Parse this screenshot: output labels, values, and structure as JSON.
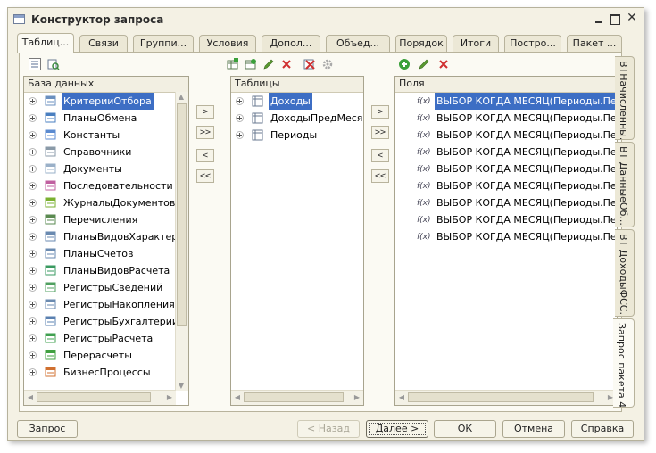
{
  "window": {
    "title": "Конструктор запроса"
  },
  "tabs": [
    {
      "label": "Таблиц..."
    },
    {
      "label": "Связи"
    },
    {
      "label": "Группи..."
    },
    {
      "label": "Условия"
    },
    {
      "label": "Допол..."
    },
    {
      "label": "Объед..."
    },
    {
      "label": "Порядок"
    },
    {
      "label": "Итоги"
    },
    {
      "label": "Постро..."
    },
    {
      "label": "Пакет ..."
    }
  ],
  "side_tabs": [
    {
      "label": "ВТНачисленны..."
    },
    {
      "label": "ВТ ДанныеОб..."
    },
    {
      "label": "ВТ ДоходыФСС..."
    },
    {
      "label": "Запрос пакета 4"
    }
  ],
  "database": {
    "header": "База данных",
    "items": [
      {
        "label": "КритерииОтбора",
        "icon": "filter-criteria-icon",
        "color": "#6a8fbf"
      },
      {
        "label": "ПланыОбмена",
        "icon": "exchange-plan-icon",
        "color": "#4a7fc0"
      },
      {
        "label": "Константы",
        "icon": "constants-icon",
        "color": "#5a8ad0"
      },
      {
        "label": "Справочники",
        "icon": "catalog-icon",
        "color": "#8a9aa8"
      },
      {
        "label": "Документы",
        "icon": "document-icon",
        "color": "#9ab0c8"
      },
      {
        "label": "Последовательности",
        "icon": "sequence-icon",
        "color": "#c060a0"
      },
      {
        "label": "ЖурналыДокументов",
        "icon": "document-journal-icon",
        "color": "#7ab030"
      },
      {
        "label": "Перечисления",
        "icon": "enumeration-icon",
        "color": "#5a8a50"
      },
      {
        "label": "ПланыВидовХарактерис",
        "icon": "characteristic-plan-icon",
        "color": "#6a8ab0"
      },
      {
        "label": "ПланыСчетов",
        "icon": "chart-of-accounts-icon",
        "color": "#6a8ab0"
      },
      {
        "label": "ПланыВидовРасчета",
        "icon": "calculation-plan-icon",
        "color": "#3a9a60"
      },
      {
        "label": "РегистрыСведений",
        "icon": "info-register-icon",
        "color": "#50a060"
      },
      {
        "label": "РегистрыНакопления",
        "icon": "accumulation-register-icon",
        "color": "#6a8ab0"
      },
      {
        "label": "РегистрыБухгалтерии",
        "icon": "accounting-register-icon",
        "color": "#5a80b0"
      },
      {
        "label": "РегистрыРасчета",
        "icon": "calculation-register-icon",
        "color": "#40a050"
      },
      {
        "label": "Перерасчеты",
        "icon": "recalculation-icon",
        "color": "#40a040"
      },
      {
        "label": "БизнесПроцессы",
        "icon": "business-process-icon",
        "color": "#d07030"
      }
    ]
  },
  "tables": {
    "header": "Таблицы",
    "items": [
      {
        "label": "Доходы",
        "icon": "temp-table-icon",
        "selected": true
      },
      {
        "label": "ДоходыПредМесяца",
        "icon": "temp-table-icon",
        "selected": false
      },
      {
        "label": "Периоды",
        "icon": "temp-table-icon",
        "selected": false
      }
    ]
  },
  "fields": {
    "header": "Поля",
    "items": [
      {
        "label": "ВЫБОР КОГДА МЕСЯЦ(Периоды.Перио",
        "selected": true
      },
      {
        "label": "ВЫБОР КОГДА МЕСЯЦ(Периоды.Перио",
        "selected": false
      },
      {
        "label": "ВЫБОР КОГДА МЕСЯЦ(Периоды.Перио",
        "selected": false
      },
      {
        "label": "ВЫБОР КОГДА МЕСЯЦ(Периоды.Перио",
        "selected": false
      },
      {
        "label": "ВЫБОР КОГДА МЕСЯЦ(Периоды.Перио",
        "selected": false
      },
      {
        "label": "ВЫБОР КОГДА МЕСЯЦ(Периоды.Перио",
        "selected": false
      },
      {
        "label": "ВЫБОР КОГДА МЕСЯЦ(Периоды.Перио",
        "selected": false
      },
      {
        "label": "ВЫБОР КОГДА МЕСЯЦ(Периоды.Перио",
        "selected": false
      },
      {
        "label": "ВЫБОР КОГДА МЕСЯЦ(Периоды.Перио",
        "selected": false
      }
    ]
  },
  "move_buttons": [
    ">",
    ">>",
    "<",
    "<<"
  ],
  "bottom": {
    "query": "Запрос",
    "back": "< Назад",
    "next": "Далее >",
    "ok": "ОК",
    "cancel": "Отмена",
    "help": "Справка"
  },
  "colors": {
    "selection": "#3d6ec4",
    "window_bg": "#f4f1e4",
    "add_icon": "#3aa03a",
    "delete_icon": "#d03030",
    "edit_icon": "#5a9a30"
  }
}
